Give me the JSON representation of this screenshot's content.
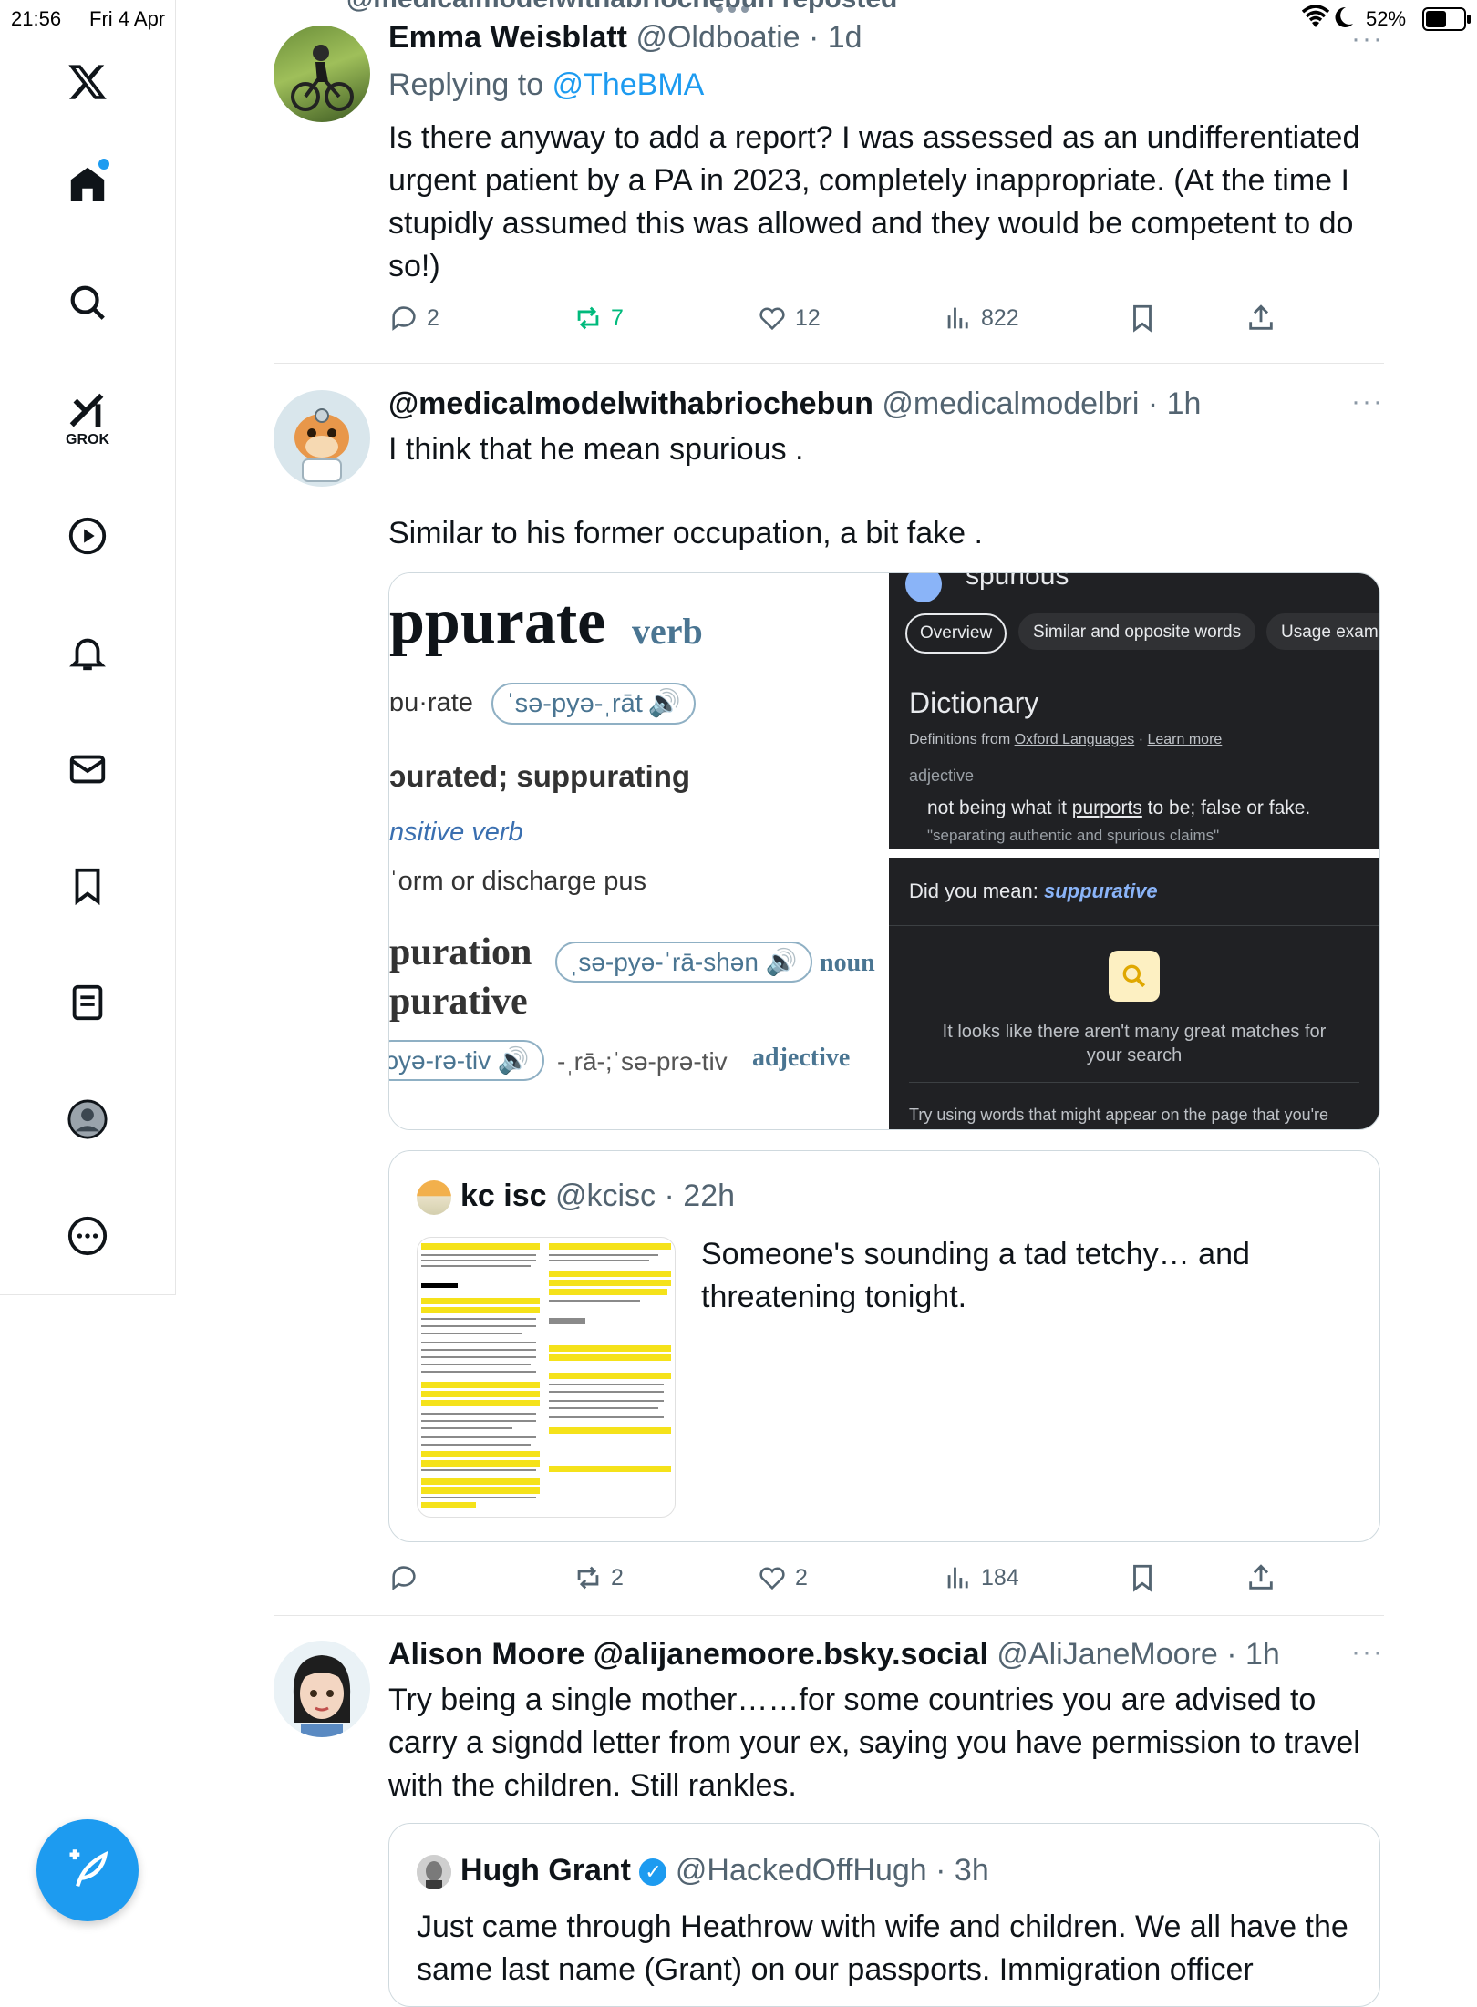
{
  "status": {
    "time": "21:56",
    "date": "Fri 4 Apr",
    "battery": "52%"
  },
  "header": {
    "reposted": "@medicalmodelwithabriochebun reposted"
  },
  "sidebar": {
    "items": [
      {
        "name": "x-logo"
      },
      {
        "name": "home"
      },
      {
        "name": "search"
      },
      {
        "name": "grok",
        "label": "GROK"
      },
      {
        "name": "video"
      },
      {
        "name": "notifications"
      },
      {
        "name": "messages"
      },
      {
        "name": "bookmarks"
      },
      {
        "name": "lists"
      },
      {
        "name": "profile"
      },
      {
        "name": "more"
      }
    ]
  },
  "tweets": [
    {
      "name": "Emma Weisblatt",
      "handle": "@Oldboatie",
      "time": "· 1d",
      "reply_prefix": "Replying to ",
      "reply_to": "@TheBMA",
      "text": "Is there anyway to add a report? I was assessed as an undifferentiated urgent patient by a PA in 2023, completely inappropriate. (At the time I stupidly assumed this was allowed and they would be competent to do so!)",
      "stats": {
        "replies": "2",
        "reposts": "7",
        "likes": "12",
        "views": "822"
      }
    },
    {
      "name": "@medicalmodelwithabriochebun",
      "handle": "@medicalmodelbri",
      "time": "· 1h",
      "text1": "I think that he mean spurious .",
      "text2": "Similar to his  former occupation, a bit fake .",
      "media_left": {
        "word": "ppurate",
        "pos": "verb",
        "syll": "ɒu·rate",
        "pron": "ˈsə-pyə-ˌrāt",
        "inflections": "ɔurated; suppurating",
        "type": "nsitive verb",
        "def": "ˈorm or discharge pus",
        "deriv1": "puration",
        "deriv1_pron": "ˌsə-pyə-ˈrā-shən",
        "deriv1_pos": "noun",
        "deriv2": "purative",
        "deriv2_pron": "ɔyə-rə-tiv",
        "deriv2_alt": "-ˌrā-;ˈsə-prə-tiv",
        "deriv2_pos": "adjective"
      },
      "media_right": {
        "word": "spurious",
        "tabs": [
          "Overview",
          "Similar and opposite words",
          "Usage examp"
        ],
        "dict_title": "Dictionary",
        "source_prefix": "Definitions from ",
        "source": "Oxford Languages",
        "learn_more": "Learn more",
        "pos": "adjective",
        "def_prefix": "not being what it ",
        "def_link": "purports",
        "def_suffix": " to be; false or fake.",
        "example": "\"separating authentic and spurious claims\"",
        "did_you_mean_label": "Did you mean: ",
        "did_you_mean": "suppurative",
        "no_match": "It looks like there aren't many great matches for your search",
        "try_text": "Try using words that might appear on the page that you're"
      },
      "quote": {
        "name": "kc isc",
        "handle": "@kcisc",
        "time": "· 22h",
        "text": "Someone's sounding a tad tetchy… and threatening tonight."
      },
      "stats": {
        "reposts": "2",
        "likes": "2",
        "views": "184"
      }
    },
    {
      "name": "Alison Moore @alijanemoore.bsky.social",
      "handle": "@AliJaneMoore",
      "time": "· 1h",
      "text": "Try being a single mother……for some countries you are advised to carry a signdd letter from your ex, saying you have permission to travel with the children. Still rankles.",
      "quote": {
        "name": "Hugh Grant",
        "handle": "@HackedOffHugh",
        "time": "· 3h",
        "text": "Just came through Heathrow with wife and children.  We all have the same last name (Grant) on our passports.  Immigration officer"
      }
    }
  ],
  "colors": {
    "accent": "#1d9bf0",
    "repost_active": "#00ba7c",
    "muted": "#536471"
  }
}
